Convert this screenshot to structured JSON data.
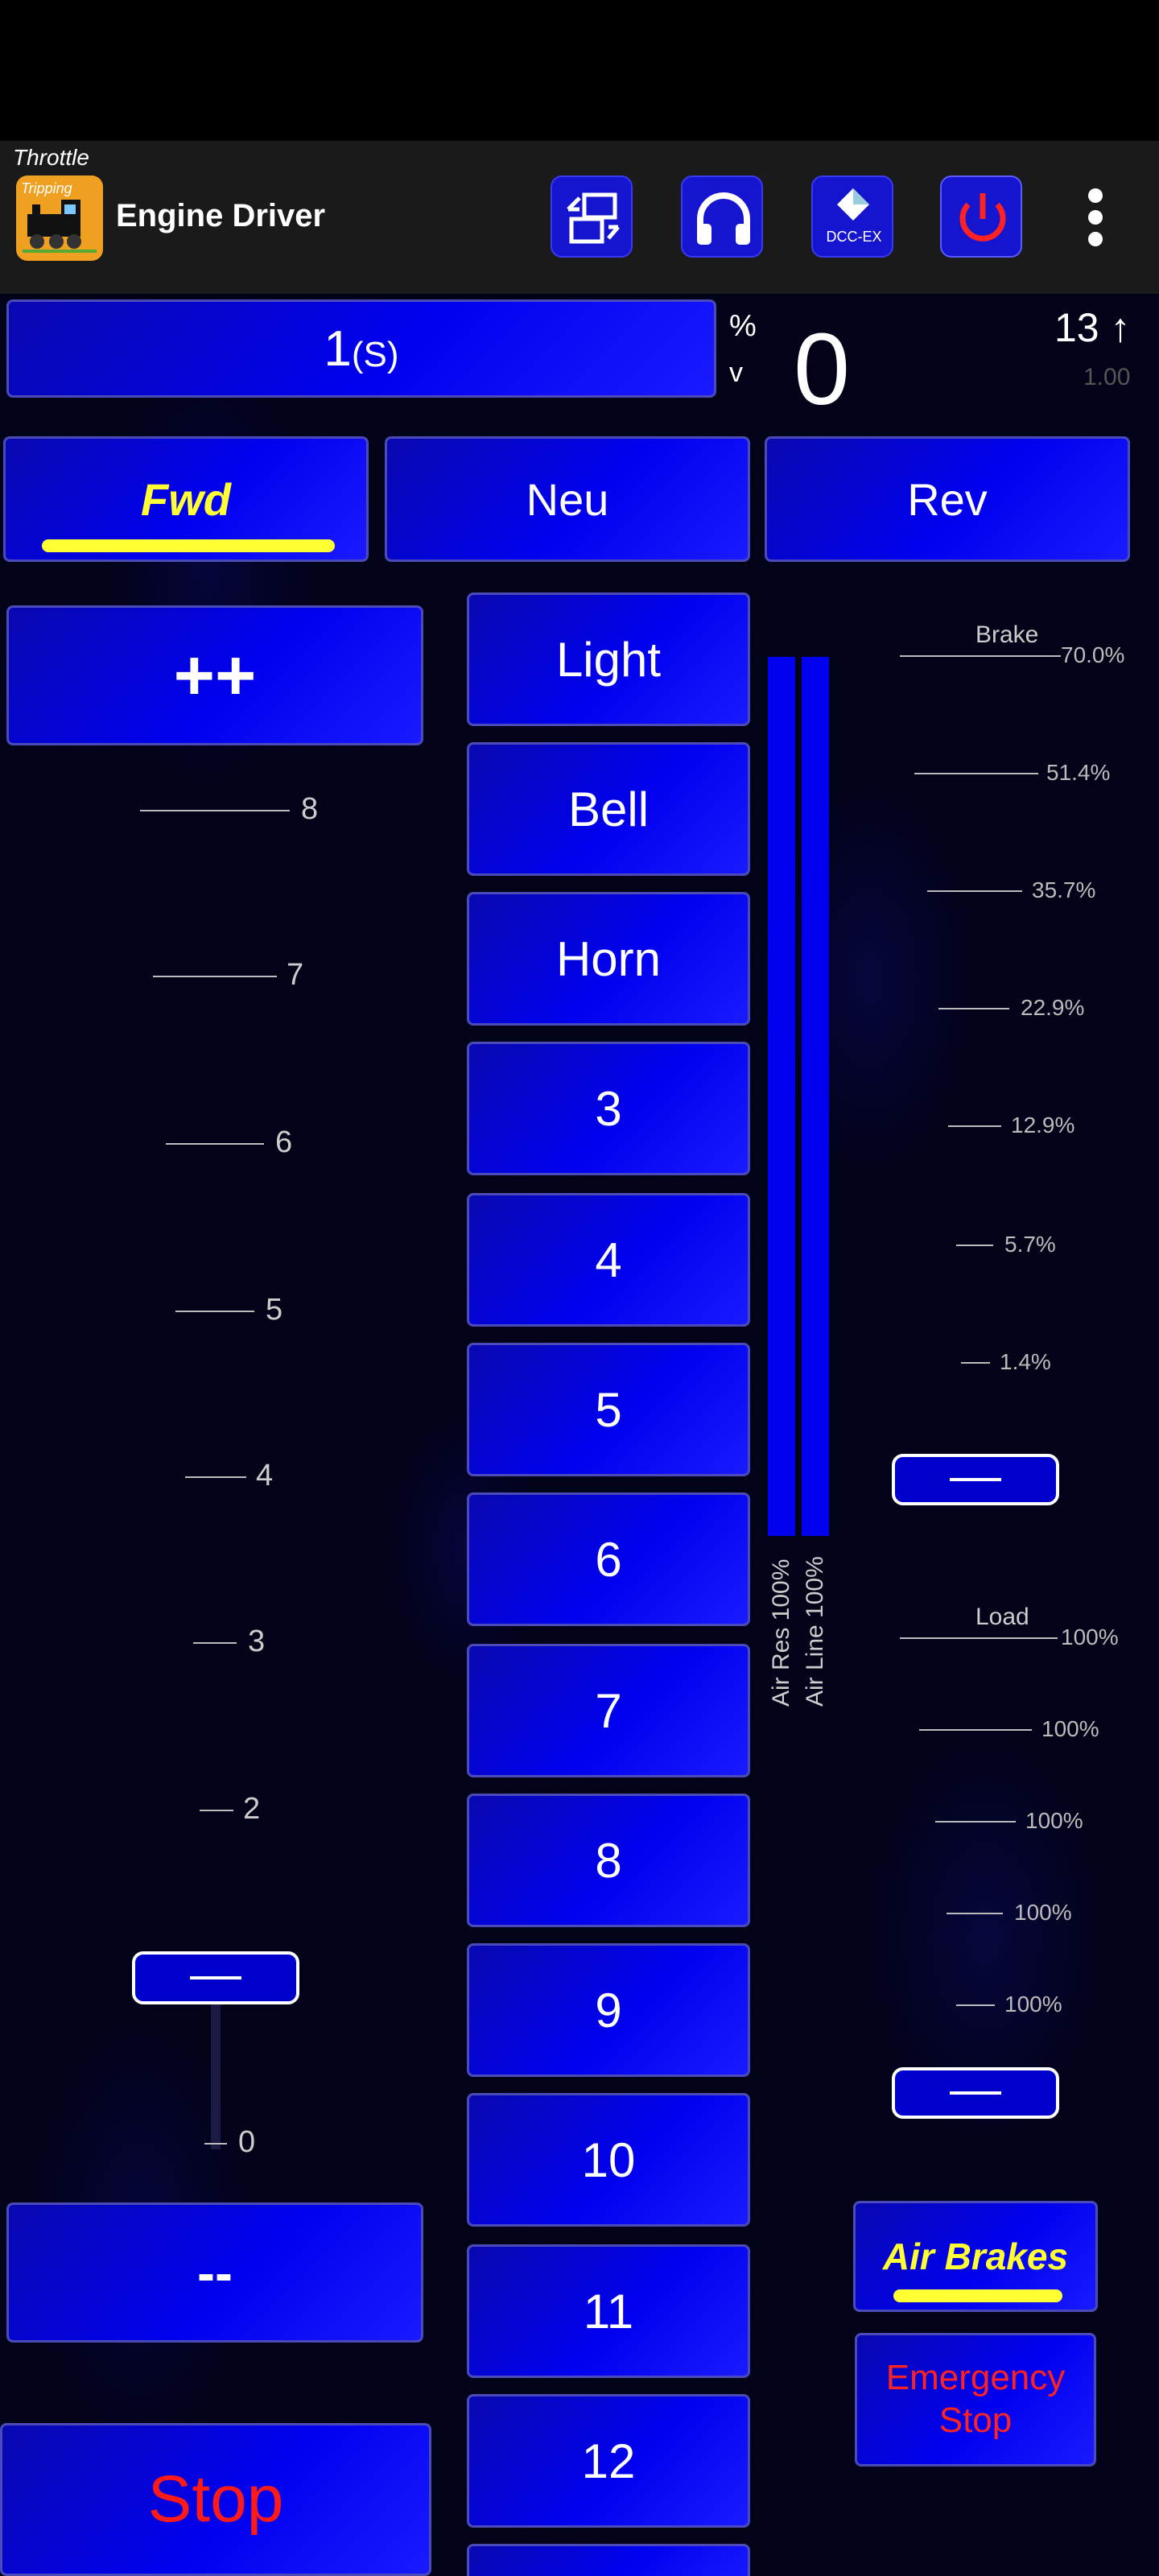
{
  "app": {
    "screen_label": "Throttle",
    "title": "Engine Driver",
    "logo_text": "Tripping",
    "icons": [
      "swap-throttle-icon",
      "headphones-icon",
      "dcc-ex-icon",
      "power-icon",
      "overflow-menu-icon"
    ],
    "dcc_ex_label": "DCC-EX"
  },
  "throttle": {
    "loco_address": "1",
    "loco_suffix": "(S)",
    "unit_percent": "%",
    "unit_v": "v",
    "speed": "0",
    "speed_steps": "13 ↑",
    "speed_multiplier": "1.00"
  },
  "direction": {
    "forward": "Fwd",
    "neutral": "Neu",
    "reverse": "Rev",
    "selected": "forward"
  },
  "controls": {
    "speed_up": "++",
    "speed_down": "--",
    "stop": "Stop",
    "throttle_notch": 0
  },
  "throttle_ticks": [
    "8",
    "7",
    "6",
    "5",
    "4",
    "3",
    "2",
    "0"
  ],
  "functions": [
    "Light",
    "Bell",
    "Horn",
    "3",
    "4",
    "5",
    "6",
    "7",
    "8",
    "9",
    "10",
    "11",
    "12"
  ],
  "gauges": {
    "air_res": "Air Res 100%",
    "air_line": "Air Line 100%",
    "air_res_level": 1.0,
    "air_line_level": 1.0
  },
  "brake": {
    "title": "Brake",
    "ticks": [
      "70.0%",
      "51.4%",
      "35.7%",
      "22.9%",
      "12.9%",
      "5.7%",
      "1.4%"
    ],
    "position": 0
  },
  "load": {
    "title": "Load",
    "ticks": [
      "100%",
      "100%",
      "100%",
      "100%",
      "100%"
    ],
    "position": 0
  },
  "bottom_right": {
    "air_brakes": "Air Brakes",
    "estop_line1": "Emergency",
    "estop_line2": "Stop"
  },
  "colors": {
    "button_blue": "#0000ee",
    "accent_yellow": "#ffff33",
    "stop_red": "#ff1a1a",
    "logo_orange": "#f0a020"
  }
}
